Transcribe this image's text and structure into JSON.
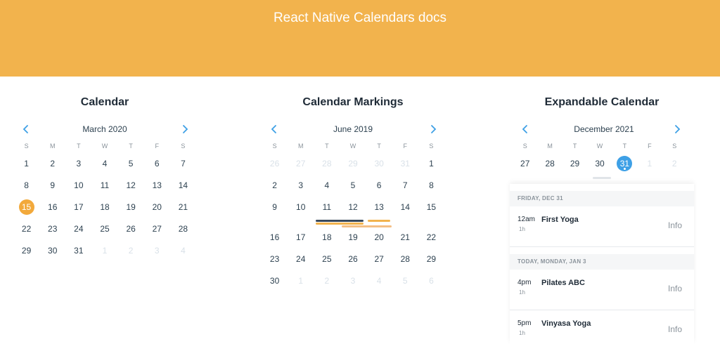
{
  "header": {
    "title": "React Native Calendars docs"
  },
  "accent": {
    "header_bg": "#f2b34d",
    "today": "#f2a93b",
    "selected": "#3ea0e6",
    "arrow": "#3ea0e6"
  },
  "weekdays": [
    "S",
    "M",
    "T",
    "W",
    "T",
    "F",
    "S"
  ],
  "calendar": {
    "title": "Calendar",
    "month": "March 2020",
    "weeks": [
      [
        "1",
        "2",
        "3",
        "4",
        "5",
        "6",
        "7"
      ],
      [
        "8",
        "9",
        "10",
        "11",
        "12",
        "13",
        "14"
      ],
      [
        "15",
        "16",
        "17",
        "18",
        "19",
        "20",
        "21"
      ],
      [
        "22",
        "23",
        "24",
        "25",
        "26",
        "27",
        "28"
      ],
      [
        "29",
        "30",
        "31",
        "1",
        "2",
        "3",
        "4"
      ]
    ],
    "today": "15"
  },
  "markings": {
    "title": "Calendar Markings",
    "month": "June 2019",
    "weeks": [
      [
        "26",
        "27",
        "28",
        "29",
        "30",
        "31",
        "1"
      ],
      [
        "2",
        "3",
        "4",
        "5",
        "6",
        "7",
        "8"
      ],
      [
        "9",
        "10",
        "11",
        "12",
        "13",
        "14",
        "15"
      ],
      [
        "16",
        "17",
        "18",
        "19",
        "20",
        "21",
        "22"
      ],
      [
        "23",
        "24",
        "25",
        "26",
        "27",
        "28",
        "29"
      ],
      [
        "30",
        "1",
        "2",
        "3",
        "4",
        "5",
        "6"
      ]
    ],
    "period_colors": [
      "#3a4a5c",
      "#f2b34d",
      "#f4bf85"
    ]
  },
  "expandable": {
    "title": "Expandable Calendar",
    "month": "December 2021",
    "week": [
      "27",
      "28",
      "29",
      "30",
      "31",
      "1",
      "2"
    ],
    "selected": "31",
    "sections": [
      {
        "heading": "FRIDAY, DEC 31",
        "items": [
          {
            "hour": "12am",
            "duration": "1h",
            "title": "First Yoga",
            "action": "Info"
          }
        ]
      },
      {
        "heading": "TODAY, MONDAY, JAN 3",
        "items": [
          {
            "hour": "4pm",
            "duration": "1h",
            "title": "Pilates ABC",
            "action": "Info"
          },
          {
            "hour": "5pm",
            "duration": "1h",
            "title": "Vinyasa Yoga",
            "action": "Info"
          }
        ]
      }
    ]
  }
}
